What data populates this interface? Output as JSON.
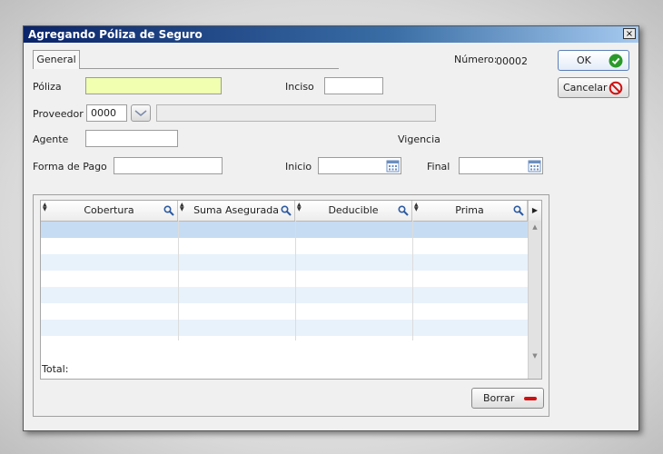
{
  "window": {
    "title": "Agregando Póliza de Seguro",
    "close_glyph": "×"
  },
  "tabs": [
    {
      "label": "General",
      "active": true
    }
  ],
  "numero": {
    "label": "Número:",
    "value": "00002"
  },
  "form": {
    "poliza_label": "Póliza",
    "poliza_value": "",
    "inciso_label": "Inciso",
    "inciso_value": "",
    "proveedor_label": "Proveedor",
    "proveedor_code": "0000",
    "proveedor_name": "",
    "agente_label": "Agente",
    "agente_value": "",
    "vigencia_label": "Vigencia",
    "forma_pago_label": "Forma de Pago",
    "forma_pago_value": "",
    "inicio_label": "Inicio",
    "inicio_value": "",
    "final_label": "Final",
    "final_value": ""
  },
  "buttons": {
    "ok_label": "OK",
    "cancel_label": "Cancelar",
    "borrar_label": "Borrar"
  },
  "grid": {
    "columns": [
      "Cobertura",
      "Suma Asegurada",
      "Deducible",
      "Prima"
    ],
    "rows": [],
    "total_label": "Total:"
  },
  "icons": {
    "ok": "check-circle-icon",
    "cancel": "no-entry-icon",
    "borrar": "minus-icon",
    "search": "search-icon",
    "calendar": "calendar-icon"
  },
  "colors": {
    "title_start": "#0a246a",
    "title_end": "#a6caf0",
    "highlight_input": "#f0ffb0",
    "ok_green": "#2a9a2a",
    "cancel_red": "#d01010",
    "selected_row": "#c6dcf2"
  }
}
